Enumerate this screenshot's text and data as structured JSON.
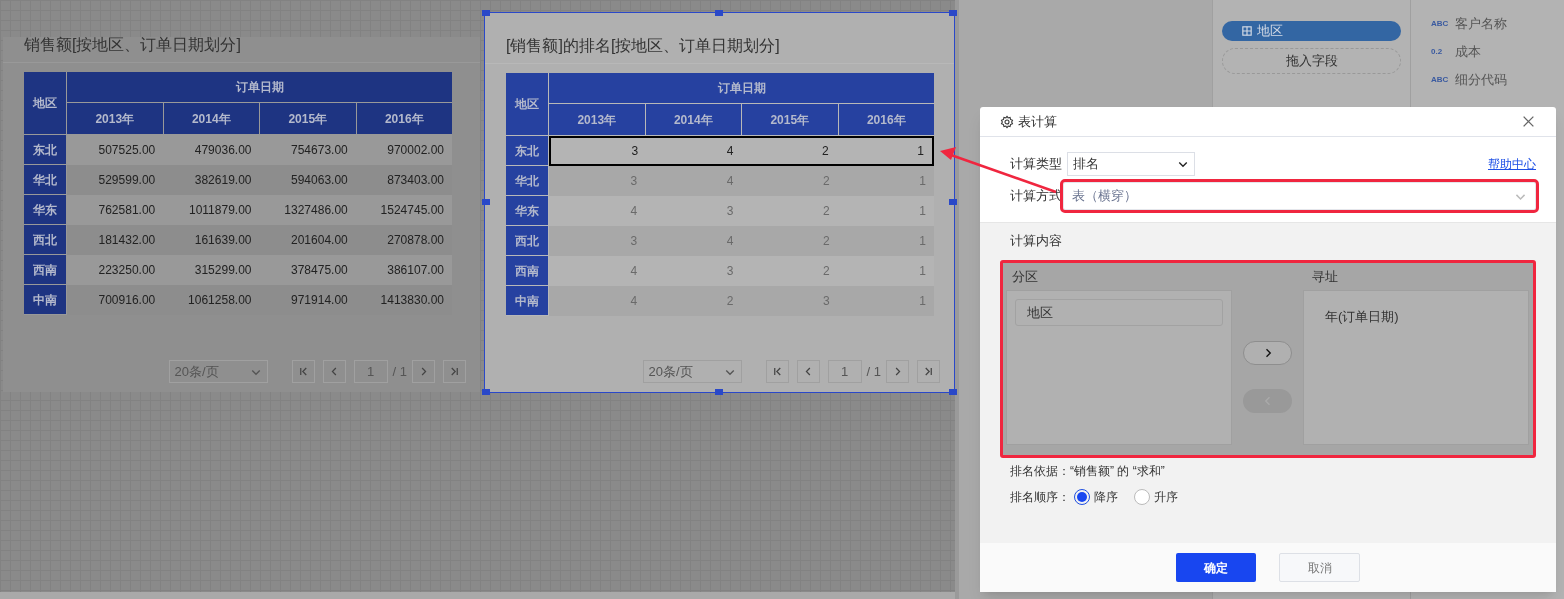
{
  "charts": [
    {
      "title": "销售额[按地区、订单日期划分]",
      "selected": false,
      "table": {
        "corner": "地区",
        "group_header": "订单日期",
        "columns": [
          "2013年",
          "2014年",
          "2015年",
          "2016年"
        ],
        "rows": [
          {
            "region": "东北",
            "highlighted": false,
            "cells": [
              "507525.00",
              "479036.00",
              "754673.00",
              "970002.00"
            ]
          },
          {
            "region": "华北",
            "highlighted": false,
            "cells": [
              "529599.00",
              "382619.00",
              "594063.00",
              "873403.00"
            ]
          },
          {
            "region": "华东",
            "highlighted": false,
            "cells": [
              "762581.00",
              "1011879.00",
              "1327486.00",
              "1524745.00"
            ]
          },
          {
            "region": "西北",
            "highlighted": false,
            "cells": [
              "181432.00",
              "161639.00",
              "201604.00",
              "270878.00"
            ]
          },
          {
            "region": "西南",
            "highlighted": false,
            "cells": [
              "223250.00",
              "315299.00",
              "378475.00",
              "386107.00"
            ]
          },
          {
            "region": "中南",
            "highlighted": false,
            "cells": [
              "700916.00",
              "1061258.00",
              "971914.00",
              "1413830.00"
            ]
          }
        ]
      },
      "pagination": {
        "page_size": "20条/页",
        "page": "1",
        "total": "/ 1"
      }
    },
    {
      "title": "[销售额]的排名[按地区、订单日期划分]",
      "selected": true,
      "table": {
        "corner": "地区",
        "group_header": "订单日期",
        "columns": [
          "2013年",
          "2014年",
          "2015年",
          "2016年"
        ],
        "rows": [
          {
            "region": "东北",
            "highlighted": true,
            "cells": [
              "3",
              "4",
              "2",
              "1"
            ]
          },
          {
            "region": "华北",
            "highlighted": false,
            "cells": [
              "3",
              "4",
              "2",
              "1"
            ]
          },
          {
            "region": "华东",
            "highlighted": false,
            "cells": [
              "4",
              "3",
              "2",
              "1"
            ]
          },
          {
            "region": "西北",
            "highlighted": false,
            "cells": [
              "3",
              "4",
              "2",
              "1"
            ]
          },
          {
            "region": "西南",
            "highlighted": false,
            "cells": [
              "4",
              "3",
              "2",
              "1"
            ]
          },
          {
            "region": "中南",
            "highlighted": false,
            "cells": [
              "4",
              "2",
              "3",
              "1"
            ]
          }
        ]
      },
      "pagination": {
        "page_size": "20条/页",
        "page": "1",
        "total": "/ 1"
      }
    }
  ],
  "right_panel": {
    "axis_chip": "地区",
    "drop_zone": "拖入字段",
    "fields": [
      {
        "type": "ABC",
        "name": "客户名称"
      },
      {
        "type": "0.2",
        "name": "成本"
      },
      {
        "type": "ABC",
        "name": "细分代码"
      }
    ]
  },
  "dialog": {
    "title": "表计算",
    "calc_type": {
      "label": "计算类型",
      "value": "排名"
    },
    "help_link": "帮助中心",
    "calc_method": {
      "label": "计算方式",
      "value": "表（横穿）"
    },
    "content_label": "计算内容",
    "partition": {
      "label": "分区",
      "items": [
        "地区"
      ]
    },
    "addressing": {
      "label": "寻址",
      "items": [
        "年(订单日期)"
      ]
    },
    "move_buttons": [
      {
        "kind": "right",
        "disabled": false
      },
      {
        "kind": "left",
        "disabled": true
      }
    ],
    "rank_basis": "排名依据：“销售额” 的 “求和”",
    "order": {
      "label": "排名顺序：",
      "options": [
        {
          "label": "降序",
          "selected": true
        },
        {
          "label": "升序",
          "selected": false
        }
      ]
    },
    "confirm": "确定",
    "cancel": "取消"
  }
}
